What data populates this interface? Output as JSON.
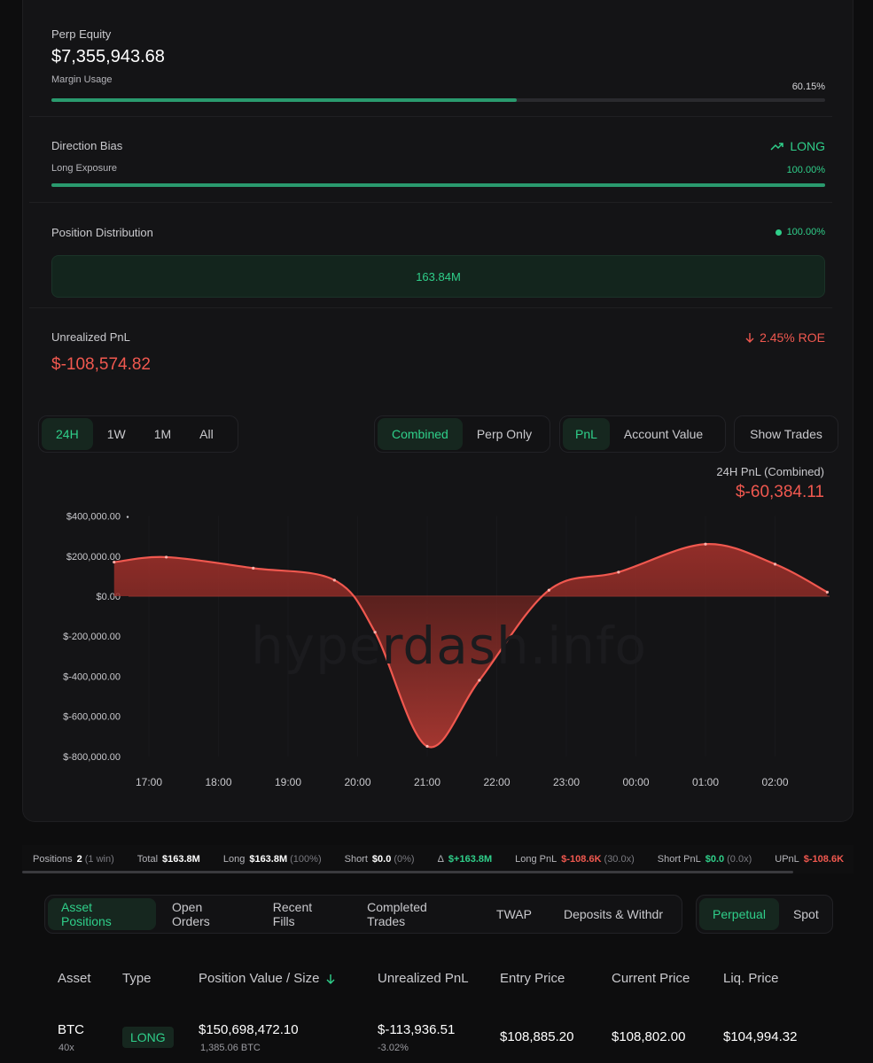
{
  "perp_equity": {
    "label": "Perp Equity",
    "value": "$7,355,943.68",
    "margin_label": "Margin Usage",
    "margin_value": "60.15%",
    "margin_fraction": 0.6015
  },
  "direction": {
    "label": "Direction Bias",
    "bias": "LONG",
    "exposure_label": "Long Exposure",
    "exposure_value": "100.00%",
    "exposure_fraction": 1.0
  },
  "distribution": {
    "label": "Position Distribution",
    "pct": "100.00%",
    "value": "163.84M"
  },
  "upnl": {
    "label": "Unrealized PnL",
    "value": "$-108,574.82",
    "roe": "2.45% ROE"
  },
  "range_tabs": [
    "24H",
    "1W",
    "1M",
    "All"
  ],
  "mode_tabs": [
    "Combined",
    "Perp Only"
  ],
  "metric_tabs": [
    "PnL",
    "Account Value"
  ],
  "show_trades": "Show Trades",
  "chart_title": "24H PnL (Combined)",
  "chart_total": "$-60,384.11",
  "watermark": "hyperdash.info",
  "chart_data": {
    "type": "area",
    "title": "24H PnL (Combined)",
    "y_ticks": [
      "$400,000.00",
      "$200,000.00",
      "$0.00",
      "$-200,000.00",
      "$-400,000.00",
      "$-600,000.00",
      "$-800,000.00"
    ],
    "x_ticks": [
      "17:00",
      "18:00",
      "19:00",
      "20:00",
      "21:00",
      "22:00",
      "23:00",
      "00:00",
      "01:00",
      "02:00"
    ],
    "ylim": [
      -800000,
      400000
    ],
    "x": [
      "16:30",
      "17:15",
      "18:30",
      "19:40",
      "20:15",
      "21:00",
      "21:45",
      "22:45",
      "23:45",
      "01:00",
      "02:00",
      "02:45"
    ],
    "values": [
      170000,
      195000,
      140000,
      80000,
      -180000,
      -750000,
      -420000,
      30000,
      120000,
      260000,
      160000,
      20000
    ],
    "color": "#f0584f"
  },
  "stats": [
    {
      "k": "Positions",
      "v": "2",
      "m": "(1 win)"
    },
    {
      "k": "Total",
      "v": "$163.8M",
      "m": ""
    },
    {
      "k": "Long",
      "v": "$163.8M",
      "m": "(100%)"
    },
    {
      "k": "Short",
      "v": "$0.0",
      "m": "(0%)"
    },
    {
      "k": "Δ",
      "v": "$+163.8M",
      "m": ""
    },
    {
      "k": "Long PnL",
      "v": "$-108.6K",
      "m": "(30.0x)"
    },
    {
      "k": "Short PnL",
      "v": "$0.0",
      "m": "(0.0x)"
    },
    {
      "k": "UPnL",
      "v": "$-108.6K",
      "m": ""
    }
  ],
  "position_tabs": [
    "Asset Positions",
    "Open Orders",
    "Recent Fills",
    "Completed Trades",
    "TWAP",
    "Deposits & Withdr"
  ],
  "market_tabs": [
    "Perpetual",
    "Spot"
  ],
  "table": {
    "headers": [
      "Asset",
      "Type",
      "Position Value / Size",
      "Unrealized PnL",
      "Entry Price",
      "Current Price",
      "Liq. Price"
    ],
    "sort_icon": "arrow-down-icon",
    "rows": [
      {
        "asset": "BTC",
        "leverage": "40x",
        "type": "LONG",
        "value": "$150,698,472.10",
        "size": "1,385.06 BTC",
        "pnl": "$-113,936.51",
        "pnl_pct": "-3.02%",
        "entry": "$108,885.20",
        "current": "$108,802.00",
        "liq": "$104,994.32"
      }
    ]
  },
  "colors": {
    "accent": "#2fcf8a",
    "negative": "#f0584f",
    "bg": "#141416"
  }
}
